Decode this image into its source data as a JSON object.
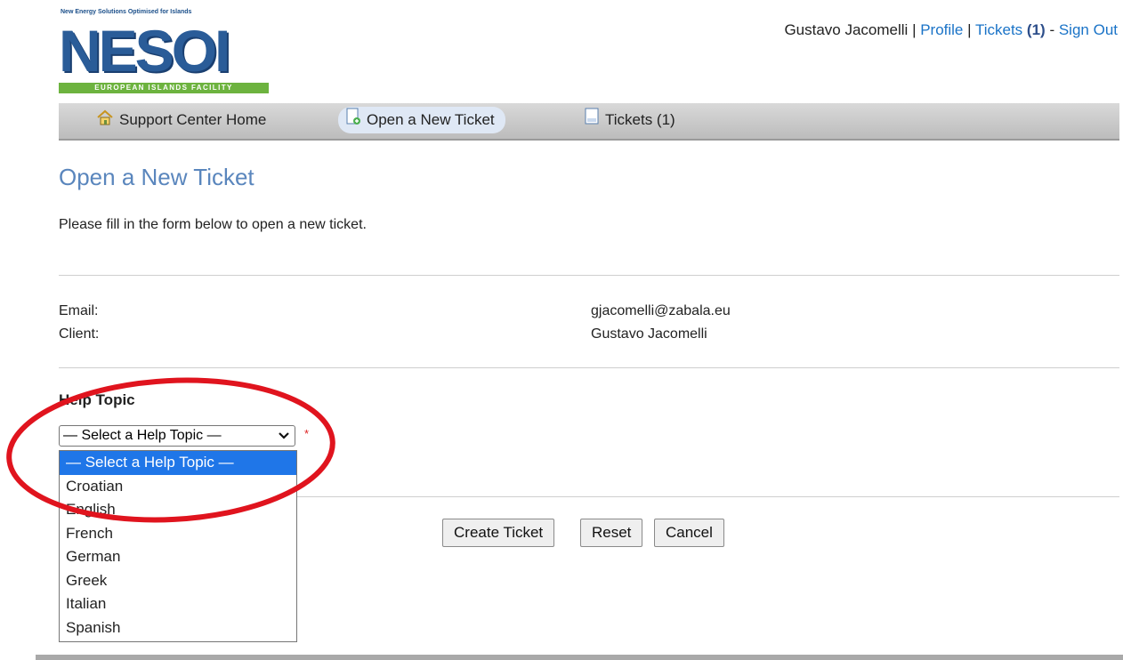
{
  "logo": {
    "tagline": "New Energy Solutions Optimised for Islands",
    "word": "NESOI",
    "band": "EUROPEAN ISLANDS FACILITY",
    "colors": {
      "primary": "#2a5c98",
      "accent": "#6db33f"
    }
  },
  "userbar": {
    "name": "Gustavo Jacomelli",
    "profile": "Profile",
    "tickets": "Tickets",
    "tickets_count": "(1)",
    "dash": "-",
    "signout": "Sign Out"
  },
  "nav": {
    "items": [
      {
        "label": "Support Center Home",
        "icon": "home-icon"
      },
      {
        "label": "Open a New Ticket",
        "icon": "new-ticket-icon",
        "active": true
      },
      {
        "label": "Tickets (1)",
        "icon": "tickets-icon"
      }
    ]
  },
  "page": {
    "title": "Open a New Ticket",
    "intro": "Please fill in the form below to open a new ticket."
  },
  "info": {
    "email_label": "Email:",
    "email_value": "gjacomelli@zabala.eu",
    "client_label": "Client:",
    "client_value": "Gustavo Jacomelli"
  },
  "help_topic": {
    "heading": "Help Topic",
    "selected": "— Select a Help Topic —",
    "required_mark": "*",
    "options": [
      "— Select a Help Topic —",
      "Croatian",
      "English",
      "French",
      "German",
      "Greek",
      "Italian",
      "Spanish"
    ]
  },
  "buttons": {
    "create": "Create Ticket",
    "reset": "Reset",
    "cancel": "Cancel"
  },
  "annotation_color": "#e0141e"
}
